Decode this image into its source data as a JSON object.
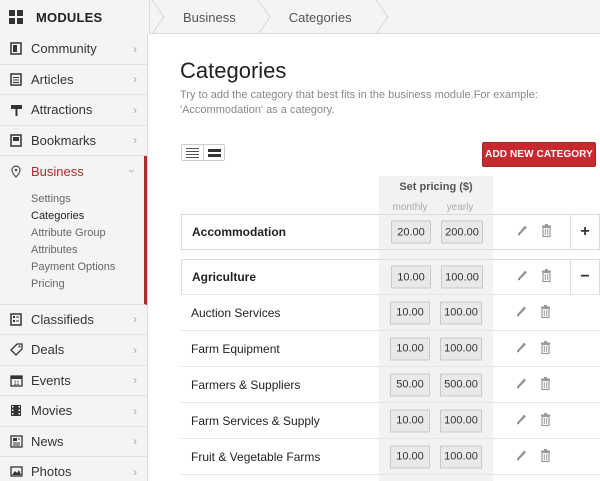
{
  "brand": {
    "title": "MODULES",
    "icon": "grid-icon"
  },
  "breadcrumb": [
    "Business",
    "Categories"
  ],
  "sidebar": {
    "items": [
      {
        "label": "Community",
        "icon": "community-icon"
      },
      {
        "label": "Articles",
        "icon": "articles-icon"
      },
      {
        "label": "Attractions",
        "icon": "signpost-icon"
      },
      {
        "label": "Bookmarks",
        "icon": "bookmark-icon"
      },
      {
        "label": "Business",
        "icon": "location-pin-icon",
        "active": true
      },
      {
        "label": "Classifieds",
        "icon": "classifieds-icon"
      },
      {
        "label": "Deals",
        "icon": "tag-icon"
      },
      {
        "label": "Events",
        "icon": "calendar-icon"
      },
      {
        "label": "Movies",
        "icon": "film-icon"
      },
      {
        "label": "News",
        "icon": "news-icon"
      },
      {
        "label": "Photos",
        "icon": "photo-icon"
      }
    ],
    "business_sub": [
      "Settings",
      "Categories",
      "Attribute Group",
      "Attributes",
      "Payment Options",
      "Pricing"
    ],
    "business_sub_current": "Categories"
  },
  "main": {
    "title": "Categories",
    "description": "Try to add the category that best fits in the business module.For example: 'Accommodation' as a category.",
    "add_button": "ADD NEW CATEGORY",
    "pricing_header": "Set pricing ($)",
    "monthly_label": "monthly",
    "yearly_label": "yearly"
  },
  "categories": [
    {
      "name": "Accommodation",
      "monthly": "20.00",
      "yearly": "200.00",
      "group": true,
      "toggle": "+"
    },
    {
      "name": "Agriculture",
      "monthly": "10.00",
      "yearly": "100.00",
      "group": true,
      "toggle": "−"
    },
    {
      "name": "Auction Services",
      "monthly": "10.00",
      "yearly": "100.00"
    },
    {
      "name": "Farm Equipment",
      "monthly": "10.00",
      "yearly": "100.00"
    },
    {
      "name": "Farmers & Suppliers",
      "monthly": "50.00",
      "yearly": "500.00"
    },
    {
      "name": "Farm Services & Supply",
      "monthly": "10.00",
      "yearly": "100.00"
    },
    {
      "name": "Fruit & Vegetable Farms",
      "monthly": "10.00",
      "yearly": "100.00"
    }
  ],
  "colors": {
    "accent": "#b5282d",
    "button": "#c62a2f"
  }
}
